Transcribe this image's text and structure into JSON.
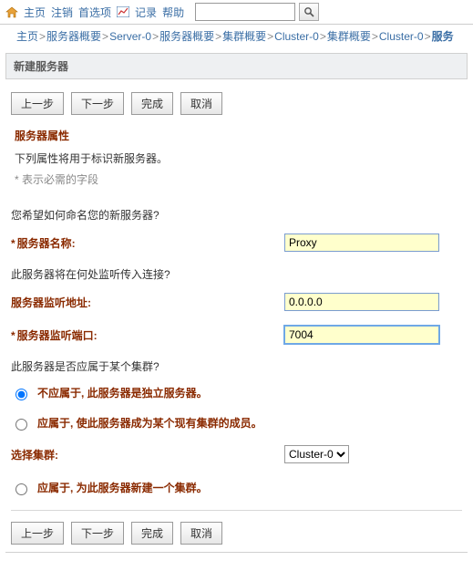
{
  "topbar": {
    "home": "主页",
    "logout": "注销",
    "prefs": "首选项",
    "log": "记录",
    "help": "帮助"
  },
  "breadcrumb": {
    "items": [
      "主页",
      "服务器概要",
      "Server-0",
      "服务器概要",
      "集群概要",
      "Cluster-0",
      "集群概要",
      "Cluster-0"
    ],
    "current": "服务"
  },
  "panel": {
    "title": "新建服务器"
  },
  "buttons": {
    "back": "上一步",
    "next": "下一步",
    "finish": "完成",
    "cancel": "取消"
  },
  "section": {
    "title": "服务器属性",
    "desc": "下列属性将用于标识新服务器。",
    "req": "* 表示必需的字段"
  },
  "q1": "您希望如何命名您的新服务器?",
  "field_name": {
    "label": "服务器名称:",
    "value": "Proxy"
  },
  "q2": "此服务器将在何处监听传入连接?",
  "field_addr": {
    "label": "服务器监听地址:",
    "value": "0.0.0.0"
  },
  "field_port": {
    "label": "服务器监听端口:",
    "value": "7004"
  },
  "q3": "此服务器是否应属于某个集群?",
  "radios": {
    "r1": "不应属于, 此服务器是独立服务器。",
    "r2": "应属于, 使此服务器成为某个现有集群的成员。",
    "r3": "应属于, 为此服务器新建一个集群。"
  },
  "cluster_select": {
    "label": "选择集群:",
    "value": "Cluster-0"
  }
}
